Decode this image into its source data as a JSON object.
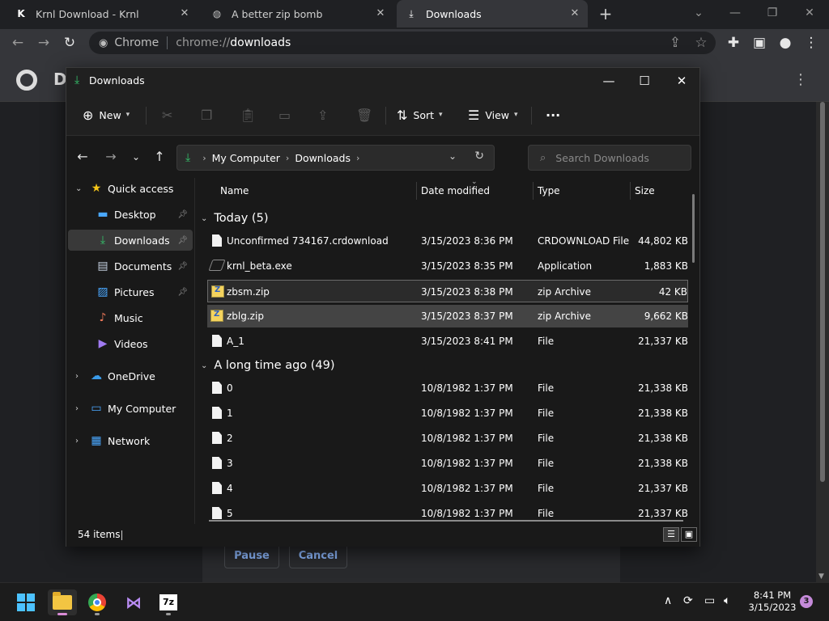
{
  "browser": {
    "tabs": [
      {
        "title": "Krnl Download - Krnl",
        "icon": "krnl-logo-icon"
      },
      {
        "title": "A better zip bomb",
        "icon": "globe-icon"
      },
      {
        "title": "Downloads",
        "icon": "download-icon"
      }
    ],
    "new_tab": "+",
    "omnibox": {
      "chip": "Chrome",
      "url_prefix": "chrome://",
      "url_host": "downloads"
    },
    "page_title": "D",
    "pause_label": "Pause",
    "cancel_label": "Cancel"
  },
  "explorer": {
    "title": "Downloads",
    "commands": {
      "new": "New",
      "sort": "Sort",
      "view": "View",
      "more": "···"
    },
    "breadcrumb": [
      "My Computer",
      "Downloads"
    ],
    "search_placeholder": "Search Downloads",
    "sidebar": {
      "quick_access": "Quick access",
      "items": [
        {
          "label": "Desktop",
          "pinned": true
        },
        {
          "label": "Downloads",
          "pinned": true,
          "selected": true
        },
        {
          "label": "Documents",
          "pinned": true
        },
        {
          "label": "Pictures",
          "pinned": true
        },
        {
          "label": "Music",
          "pinned": false
        },
        {
          "label": "Videos",
          "pinned": false
        }
      ],
      "onedrive": "OneDrive",
      "my_computer": "My Computer",
      "network": "Network"
    },
    "columns": {
      "name": "Name",
      "date": "Date modified",
      "type": "Type",
      "size": "Size"
    },
    "groups": [
      {
        "label": "Today (5)",
        "files": [
          {
            "name": "Unconfirmed 734167.crdownload",
            "date": "3/15/2023 8:36 PM",
            "type": "CRDOWNLOAD File",
            "size": "44,802 KB",
            "icon": "doc"
          },
          {
            "name": "krnl_beta.exe",
            "date": "3/15/2023 8:35 PM",
            "type": "Application",
            "size": "1,883 KB",
            "icon": "exe"
          },
          {
            "name": "zbsm.zip",
            "date": "3/15/2023 8:38 PM",
            "type": "zip Archive",
            "size": "42 KB",
            "icon": "zip"
          },
          {
            "name": "zblg.zip",
            "date": "3/15/2023 8:37 PM",
            "type": "zip Archive",
            "size": "9,662 KB",
            "icon": "zip"
          },
          {
            "name": "A_1",
            "date": "3/15/2023 8:41 PM",
            "type": "File",
            "size": "21,337 KB",
            "icon": "doc"
          }
        ]
      },
      {
        "label": "A long time ago (49)",
        "files": [
          {
            "name": "0",
            "date": "10/8/1982 1:37 PM",
            "type": "File",
            "size": "21,338 KB",
            "icon": "doc"
          },
          {
            "name": "1",
            "date": "10/8/1982 1:37 PM",
            "type": "File",
            "size": "21,338 KB",
            "icon": "doc"
          },
          {
            "name": "2",
            "date": "10/8/1982 1:37 PM",
            "type": "File",
            "size": "21,338 KB",
            "icon": "doc"
          },
          {
            "name": "3",
            "date": "10/8/1982 1:37 PM",
            "type": "File",
            "size": "21,338 KB",
            "icon": "doc"
          },
          {
            "name": "4",
            "date": "10/8/1982 1:37 PM",
            "type": "File",
            "size": "21,337 KB",
            "icon": "doc"
          },
          {
            "name": "5",
            "date": "10/8/1982 1:37 PM",
            "type": "File",
            "size": "21,337 KB",
            "icon": "doc"
          }
        ]
      }
    ],
    "status_count": "54 items"
  },
  "taskbar": {
    "time": "8:41 PM",
    "date": "3/15/2023",
    "notification_count": "3",
    "sevenzip_label": "7z"
  },
  "colors": {
    "accent_green": "#35c26b",
    "taskbar_indicator": "#d98cd7"
  }
}
